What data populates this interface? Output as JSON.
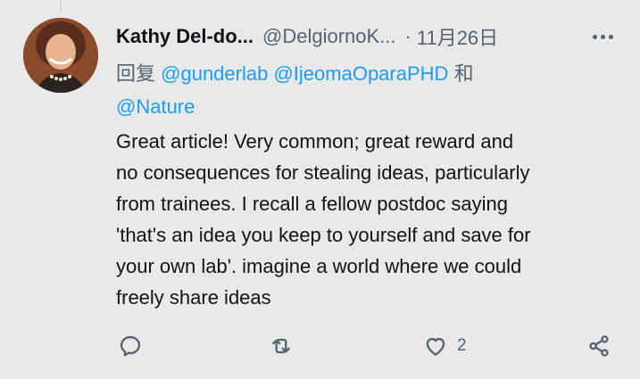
{
  "tweet": {
    "author_name": "Kathy Del-do...",
    "author_handle": "@DelgiornoK...",
    "separator": "·",
    "timestamp": "11月26日",
    "reply_prefix": "回复",
    "mentions": [
      "@gunderlab",
      "@IjeomaOparaPHD",
      "@Nature"
    ],
    "mention_joiner": "和",
    "text": "Great article! Very common; great reward and\nno consequences for stealing ideas, particularly\nfrom trainees. I recall a fellow postdoc saying\n'that's an idea you keep to yourself and save for\nyour own lab'. imagine a world where we could\nfreely share ideas",
    "actions": {
      "reply_icon": "reply-icon",
      "retweet_icon": "retweet-icon",
      "like_icon": "heart-icon",
      "like_count": "2",
      "share_icon": "share-icon"
    }
  },
  "colors": {
    "background": "#e9e9e9",
    "link": "#1d9bf0",
    "secondary": "#536471",
    "text": "#0f1419"
  }
}
